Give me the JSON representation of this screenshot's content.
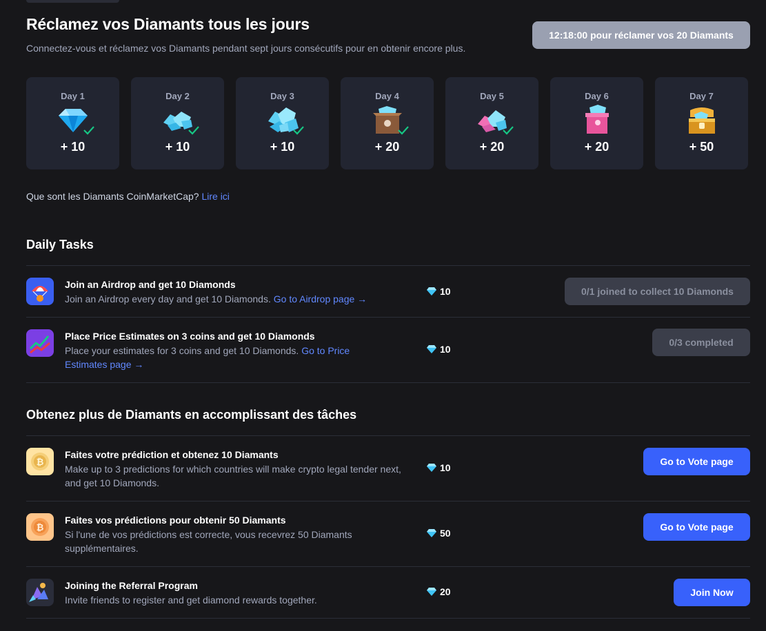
{
  "header": {
    "title": "Réclamez vos Diamants tous les jours",
    "subtitle": "Connectez-vous et réclamez vos Diamants pendant sept jours consécutifs pour en obtenir encore plus.",
    "claim_button": "12:18:00 pour réclamer vos 20 Diamants"
  },
  "days": [
    {
      "label": "Day 1",
      "amount": "+ 10",
      "claimed": true,
      "icon": "diamond-icon"
    },
    {
      "label": "Day 2",
      "amount": "+ 10",
      "claimed": true,
      "icon": "diamond-pile-icon"
    },
    {
      "label": "Day 3",
      "amount": "+ 10",
      "claimed": true,
      "icon": "diamond-pile-large-icon"
    },
    {
      "label": "Day 4",
      "amount": "+ 20",
      "claimed": true,
      "icon": "diamond-box-icon"
    },
    {
      "label": "Day 5",
      "amount": "+ 20",
      "claimed": true,
      "icon": "diamond-pile-pink-icon"
    },
    {
      "label": "Day 6",
      "amount": "+ 20",
      "claimed": false,
      "icon": "diamond-gift-box-icon"
    },
    {
      "label": "Day 7",
      "amount": "+ 50",
      "claimed": false,
      "icon": "treasure-chest-icon"
    }
  ],
  "faq": {
    "text": "Que sont les Diamants CoinMarketCap?",
    "link": "Lire ici"
  },
  "daily_tasks": {
    "title": "Daily Tasks",
    "items": [
      {
        "title": "Join an Airdrop and get 10 Diamonds",
        "desc": "Join an Airdrop every day and get 10 Diamonds.",
        "link": "Go to Airdrop page →",
        "reward": "10",
        "button": "0/1 joined to collect 10 Diamonds",
        "icon": "parachute-icon"
      },
      {
        "title": "Place Price Estimates on 3 coins and get 10 Diamonds",
        "desc": "Place your estimates for 3 coins and get 10 Diamonds.",
        "link": "Go to Price Estimates page →",
        "reward": "10",
        "button": "0/3 completed",
        "icon": "price-chart-icon"
      }
    ]
  },
  "more_tasks": {
    "title": "Obtenez plus de Diamants en accomplissant des tâches",
    "items": [
      {
        "title": "Faites votre prédiction et obtenez 10 Diamants",
        "desc": "Make up to 3 predictions for which countries will make crypto legal tender next, and get 10 Diamonds.",
        "reward": "10",
        "button": "Go to Vote page",
        "icon": "bitcoin-coin-icon"
      },
      {
        "title": "Faites vos prédictions pour obtenir 50 Diamants",
        "desc": "Si l'une de vos prédictions est correcte, vous recevrez 50 Diamants supplémentaires.",
        "reward": "50",
        "button": "Go to Vote page",
        "icon": "bitcoin-coin-orange-icon"
      },
      {
        "title": "Joining the Referral Program",
        "desc": "Invite friends to register and get diamond rewards together.",
        "reward": "20",
        "button": "Join Now",
        "icon": "referral-icon"
      }
    ]
  },
  "colors": {
    "background": "#17171a",
    "card": "#222531",
    "accent_blue": "#3861fb",
    "link_blue": "#6188ff",
    "check_green": "#16c784",
    "muted_text": "#a1a7bb",
    "disabled_button": "#3b3e4a"
  }
}
